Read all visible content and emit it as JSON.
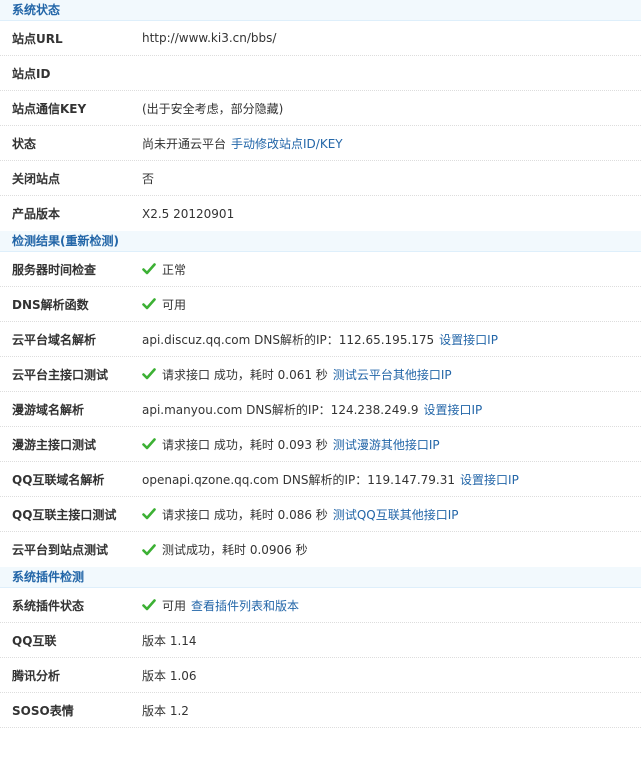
{
  "sections": {
    "system_status": {
      "title": "系统状态",
      "rows": {
        "site_url": {
          "label": "站点URL",
          "value": "http://www.ki3.cn/bbs/"
        },
        "site_id": {
          "label": "站点ID",
          "value": ""
        },
        "site_key": {
          "label": "站点通信KEY",
          "value": "(出于安全考虑，部分隐藏)"
        },
        "status": {
          "label": "状态",
          "value": "尚未开通云平台",
          "link": "手动修改站点ID/KEY"
        },
        "close_site": {
          "label": "关闭站点",
          "value": "否"
        },
        "version": {
          "label": "产品版本",
          "value": "X2.5 20120901"
        }
      }
    },
    "check_results": {
      "title_prefix": "检测结果(",
      "title_link": "重新检测",
      "title_suffix": ")",
      "rows": {
        "server_time": {
          "label": "服务器时间检查",
          "value": "正常"
        },
        "dns_func": {
          "label": "DNS解析函数",
          "value": "可用"
        },
        "cloud_domain": {
          "label": "云平台域名解析",
          "value": "api.discuz.qq.com DNS解析的IP：112.65.195.175",
          "link": "设置接口IP"
        },
        "cloud_api": {
          "label": "云平台主接口测试",
          "value": "请求接口 成功，耗时 0.061 秒",
          "link": "测试云平台其他接口IP"
        },
        "manyou_domain": {
          "label": "漫游域名解析",
          "value": "api.manyou.com DNS解析的IP：124.238.249.9",
          "link": "设置接口IP"
        },
        "manyou_api": {
          "label": "漫游主接口测试",
          "value": "请求接口 成功，耗时 0.093 秒",
          "link": "测试漫游其他接口IP"
        },
        "qq_domain": {
          "label": "QQ互联域名解析",
          "value": "openapi.qzone.qq.com DNS解析的IP：119.147.79.31",
          "link": "设置接口IP"
        },
        "qq_api": {
          "label": "QQ互联主接口测试",
          "value": "请求接口 成功，耗时 0.086 秒",
          "link": "测试QQ互联其他接口IP"
        },
        "cloud_to_site": {
          "label": "云平台到站点测试",
          "value": "测试成功，耗时 0.0906 秒"
        }
      }
    },
    "plugin_check": {
      "title": "系统插件检测",
      "rows": {
        "plugin_status": {
          "label": "系统插件状态",
          "value": "可用",
          "link": "查看插件列表和版本"
        },
        "qq_connect": {
          "label": "QQ互联",
          "value": "版本 1.14"
        },
        "tencent_analytics": {
          "label": "腾讯分析",
          "value": "版本 1.06"
        },
        "soso_emotion": {
          "label": "SOSO表情",
          "value": "版本 1.2"
        }
      }
    }
  },
  "colors": {
    "accent": "#2366a8",
    "header_bg": "#f2f9fd",
    "check_green": "#3cb034"
  },
  "icons": {
    "check": "check-icon"
  }
}
